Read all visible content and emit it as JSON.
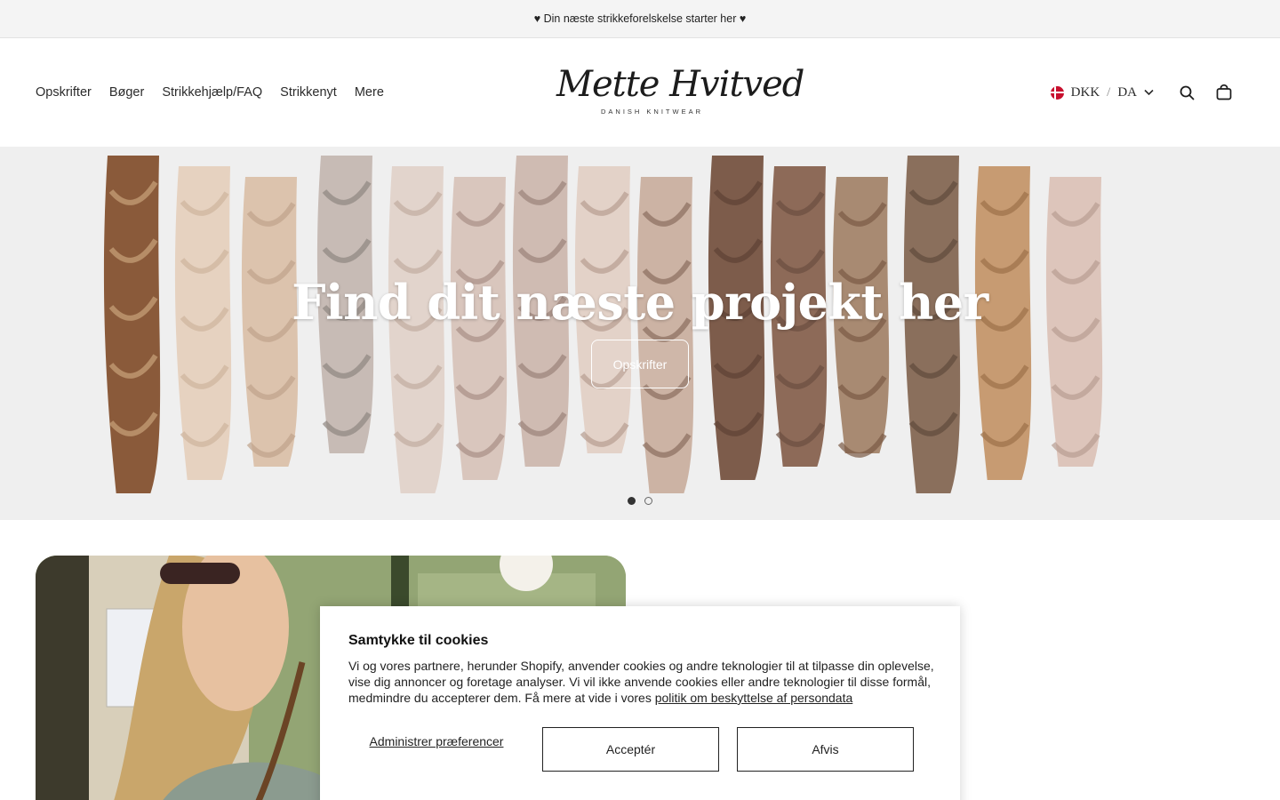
{
  "announcement": {
    "text": "♥ Din næste strikkeforelskelse starter her ♥"
  },
  "nav": {
    "items": [
      {
        "label": "Opskrifter"
      },
      {
        "label": "Bøger"
      },
      {
        "label": "Strikkehjælp/FAQ"
      },
      {
        "label": "Strikkenyt"
      },
      {
        "label": "Mere"
      }
    ]
  },
  "logo": {
    "script": "Mette Hvitved",
    "subtitle": "DANISH KNITWEAR"
  },
  "header": {
    "currency": "DKK",
    "separator": "/",
    "language": "DA",
    "icons": [
      "flag-dk-icon",
      "chevron-down-icon",
      "search-icon",
      "cart-bag-icon"
    ]
  },
  "hero": {
    "title": "Find dit næste projekt her",
    "button_label": "Opskrifter",
    "slides": 2,
    "active_slide": 1
  },
  "cookie": {
    "title": "Samtykke til cookies",
    "body": "Vi og vores partnere, herunder Shopify, anvender cookies og andre teknologier til at tilpasse din oplevelse, vise dig annoncer og foretage analyser. Vi vil ikke anvende cookies eller andre teknologier til disse formål, medmindre du accepterer dem. Få mere at vide i vores ",
    "link_text": "politik om beskyttelse af persondata",
    "manage_label": "Administrer præferencer",
    "accept_label": "Acceptér",
    "decline_label": "Afvis"
  },
  "colors": {
    "announcement_bg": "#f4f4f4",
    "text": "#1c1c1c",
    "flag_red": "#c8102e"
  }
}
